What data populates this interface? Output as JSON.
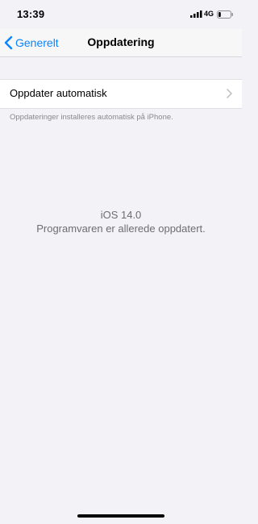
{
  "status_bar": {
    "time": "13:39",
    "network": "4G",
    "signal_icon": "cellular-signal-icon",
    "battery_icon": "battery-low-icon",
    "battery_level": 0.2
  },
  "nav": {
    "back_label": "Generelt",
    "back_icon": "chevron-left-icon",
    "title": "Oppdatering",
    "accent_color": "#0a84ff"
  },
  "settings": {
    "auto_update_label": "Oppdater automatisk",
    "auto_update_icon": "chevron-right-icon",
    "footer_note": "Oppdateringer installeres automatisk på iPhone."
  },
  "status_message": {
    "version": "iOS 14.0",
    "message": "Programvaren er allerede oppdatert."
  }
}
